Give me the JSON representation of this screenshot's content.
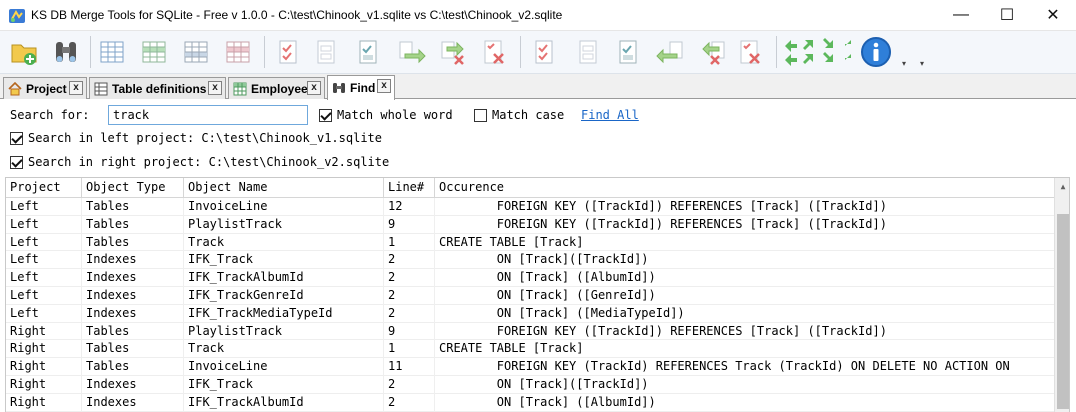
{
  "window": {
    "title": "KS DB Merge Tools for SQLite - Free v 1.0.0 - C:\\test\\Chinook_v1.sqlite vs C:\\test\\Chinook_v2.sqlite",
    "minimize": "—",
    "maximize": "☐",
    "close": "✕"
  },
  "toolbar": {
    "buttons": [
      {
        "name": "open-project-icon"
      },
      {
        "name": "find-binoculars-icon"
      },
      {
        "name": "table-view-icon"
      },
      {
        "name": "table-view-green-icon"
      },
      {
        "name": "table-view-blue-icon"
      },
      {
        "name": "table-view-pink-icon"
      },
      {
        "name": "check-doc-icon"
      },
      {
        "name": "blank-doc-icon"
      },
      {
        "name": "check-doc-teal-icon"
      },
      {
        "name": "copy-right-icon"
      },
      {
        "name": "copy-right-delete-icon"
      },
      {
        "name": "delete-doc-icon"
      },
      {
        "name": "check-doc-2-icon"
      },
      {
        "name": "blank-doc-2-icon"
      },
      {
        "name": "check-doc-teal-2-icon"
      },
      {
        "name": "copy-left-icon"
      },
      {
        "name": "copy-left-delete-icon"
      },
      {
        "name": "delete-doc-2-icon"
      },
      {
        "name": "nav-arrows-icon"
      },
      {
        "name": "info-icon"
      }
    ]
  },
  "tabs": [
    {
      "label": "Project",
      "icon": "house-icon",
      "close": "x"
    },
    {
      "label": "Table definitions",
      "icon": "table-def-icon",
      "close": "x"
    },
    {
      "label": "Employee",
      "icon": "table-icon",
      "close": "x"
    },
    {
      "label": "Find",
      "icon": "binoculars-icon",
      "close": "x"
    }
  ],
  "find": {
    "search_label": "Search for:",
    "search_value": "track",
    "match_whole_word": "Match whole word",
    "match_whole_word_checked": true,
    "match_case": "Match case",
    "match_case_checked": false,
    "find_all": "Find All",
    "left_project": "Search in left project: C:\\test\\Chinook_v1.sqlite",
    "left_checked": true,
    "right_project": "Search in right project: C:\\test\\Chinook_v2.sqlite",
    "right_checked": true
  },
  "results": {
    "columns": [
      "Project",
      "Object Type",
      "Object Name",
      "Line#",
      "Occurence"
    ],
    "rows": [
      [
        "Left",
        "Tables",
        "InvoiceLine",
        "12",
        "        FOREIGN KEY ([TrackId]) REFERENCES [Track] ([TrackId])"
      ],
      [
        "Left",
        "Tables",
        "PlaylistTrack",
        "9",
        "        FOREIGN KEY ([TrackId]) REFERENCES [Track] ([TrackId])"
      ],
      [
        "Left",
        "Tables",
        "Track",
        "1",
        "CREATE TABLE [Track]"
      ],
      [
        "Left",
        "Indexes",
        "IFK_Track",
        "2",
        "        ON [Track]([TrackId])"
      ],
      [
        "Left",
        "Indexes",
        "IFK_TrackAlbumId",
        "2",
        "        ON [Track] ([AlbumId])"
      ],
      [
        "Left",
        "Indexes",
        "IFK_TrackGenreId",
        "2",
        "        ON [Track] ([GenreId])"
      ],
      [
        "Left",
        "Indexes",
        "IFK_TrackMediaTypeId",
        "2",
        "        ON [Track] ([MediaTypeId])"
      ],
      [
        "Right",
        "Tables",
        "PlaylistTrack",
        "9",
        "        FOREIGN KEY ([TrackId]) REFERENCES [Track] ([TrackId])"
      ],
      [
        "Right",
        "Tables",
        "Track",
        "1",
        "CREATE TABLE [Track]"
      ],
      [
        "Right",
        "Tables",
        "InvoiceLine",
        "11",
        "        FOREIGN KEY (TrackId) REFERENCES Track (TrackId) ON DELETE NO ACTION ON"
      ],
      [
        "Right",
        "Indexes",
        "IFK_Track",
        "2",
        "        ON [Track]([TrackId])"
      ],
      [
        "Right",
        "Indexes",
        "IFK_TrackAlbumId",
        "2",
        "        ON [Track] ([AlbumId])"
      ]
    ]
  },
  "colors": {
    "accent": "#1a66c7",
    "grid_border": "#c9c9c9",
    "tab_border": "#9a9a9a"
  }
}
